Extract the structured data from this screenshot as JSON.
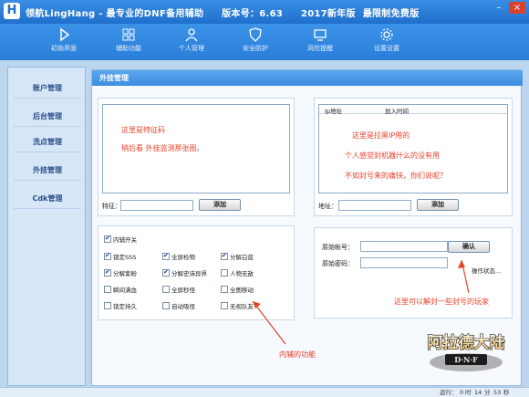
{
  "window": {
    "title": "领航LingHang - 最专业的DNF备用辅助",
    "version": "版本号：6.63",
    "edition": "2017新年版",
    "free": "最限制免费版",
    "minimize": "–",
    "close": "×"
  },
  "toolbar": [
    {
      "label": "初始界面",
      "icon": "play-icon"
    },
    {
      "label": "辅助功能",
      "icon": "grid-icon"
    },
    {
      "label": "个人管理",
      "icon": "user-icon"
    },
    {
      "label": "安全防护",
      "icon": "shield-icon"
    },
    {
      "label": "风险提醒",
      "icon": "monitor-icon"
    },
    {
      "label": "设置设置",
      "icon": "gear-icon"
    }
  ],
  "sidebar": [
    "账户管理",
    "后台管理",
    "洗点管理",
    "外挂管理",
    "Cdk管理"
  ],
  "tab": "外挂管理",
  "feature": {
    "line1": "这里是特征码",
    "line2": "稍后看 外挂监测那张图。",
    "field_label": "特征：",
    "button": "添加"
  },
  "ip": {
    "col1": "Ip地址",
    "col2": "加入时间",
    "line1": "这里是拉黑IP用的",
    "line2": "个人感觉封机器什么的没有用",
    "line3": "不如封号来的痛快，你们说呢？",
    "field_label": "地址：",
    "button": "添加"
  },
  "helper": {
    "master": "内辅开关",
    "items": [
      [
        "锁定SSS",
        "全屏检物",
        "分解白蓝"
      ],
      [
        "分解紫粉",
        "分解史诗异界",
        "人物无敌"
      ],
      [
        "瞬间满血",
        "全屏秒怪",
        "全图移动"
      ],
      [
        "锁定持久",
        "自动吸怪",
        "无视队友"
      ]
    ],
    "checked": [
      [
        true,
        true,
        true
      ],
      [
        true,
        true,
        false
      ],
      [
        false,
        false,
        false
      ],
      [
        false,
        false,
        false
      ]
    ],
    "annotation": "内辅的功能"
  },
  "account": {
    "label1": "原始帐号：",
    "label2": "原始密码：",
    "button": "确认",
    "status": "操作状态...",
    "annotation": "这里可以解封一些封号的玩家"
  },
  "logo": {
    "text": "阿拉德大陆",
    "sub": "D·N·F"
  },
  "status": {
    "label": "运行：",
    "h": "0",
    "h_unit": "时",
    "m": "14",
    "m_unit": "分",
    "s": "53",
    "s_unit": "秒"
  }
}
